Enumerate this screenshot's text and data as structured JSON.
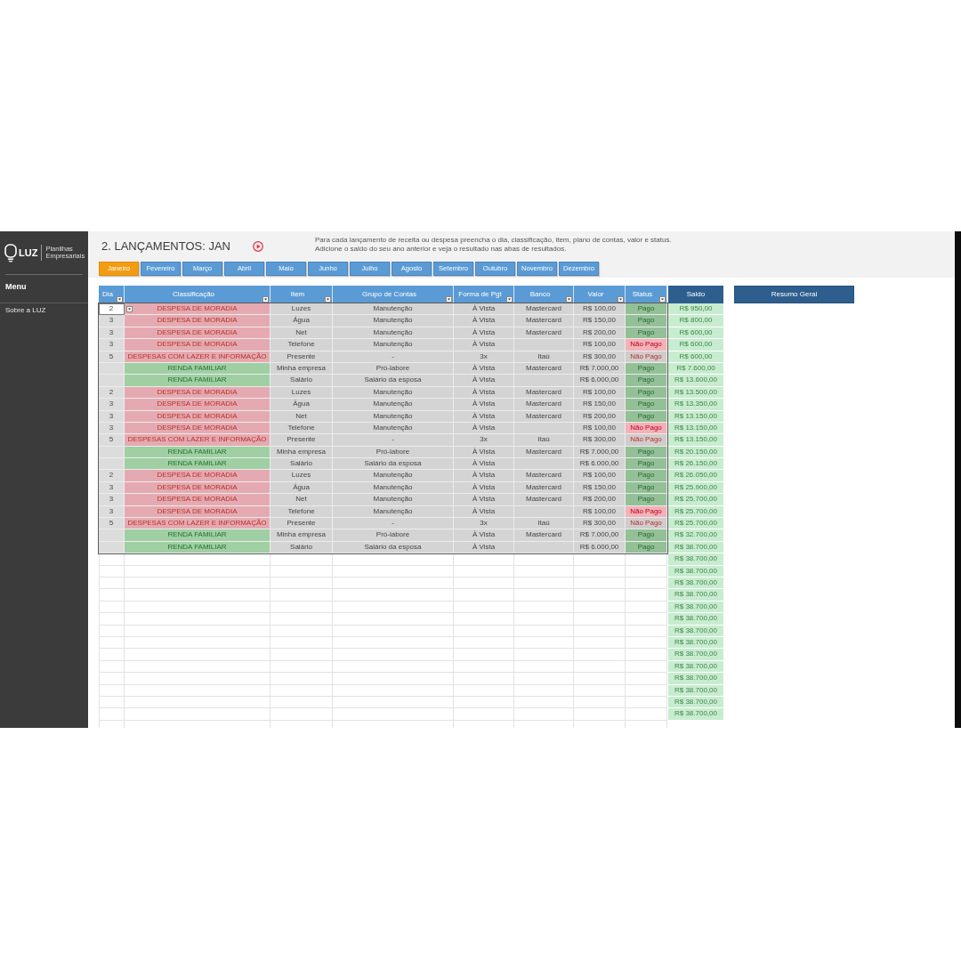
{
  "sidebar": {
    "logo_text": "LUZ",
    "logo_tagline": "Planilhas Empresariais",
    "menu_title": "Menu",
    "items": [
      {
        "label": "Sobre a LUZ"
      }
    ]
  },
  "header": {
    "title": "2. LANÇAMENTOS: JAN",
    "description": "Para cada lançamento de receita ou despesa preencha o dia, classificação, item, plano de contas, valor e status. Adicione o saldo do seu ano anterior e veja o resultado nas abas de resultados.",
    "months": [
      {
        "label": "Janeiro",
        "selected": true
      },
      {
        "label": "Fevereiro",
        "selected": false
      },
      {
        "label": "Março",
        "selected": false
      },
      {
        "label": "Abril",
        "selected": false
      },
      {
        "label": "Maio",
        "selected": false
      },
      {
        "label": "Junho",
        "selected": false
      },
      {
        "label": "Julho",
        "selected": false
      },
      {
        "label": "Agosto",
        "selected": false
      },
      {
        "label": "Setembro",
        "selected": false
      },
      {
        "label": "Outubro",
        "selected": false
      },
      {
        "label": "Novembro",
        "selected": false
      },
      {
        "label": "Dezembro",
        "selected": false
      }
    ]
  },
  "table": {
    "columns": [
      "Dia",
      "Classificação",
      "Item",
      "Grupo de Contas",
      "Forma de Pgt",
      "Banco",
      "Valor",
      "Status"
    ],
    "balance_column": "Saldo",
    "rows": [
      {
        "selected": true,
        "day": "2",
        "classification": {
          "label": "DESPESA DE MORADIA",
          "kind": "expense"
        },
        "item": "Luzes",
        "account_group": "Manutenção",
        "payment": "À Vista",
        "bank": "Mastercard",
        "value": "R$ 100,00",
        "status": {
          "label": "Pago",
          "kind": "paid"
        },
        "balance": "R$ 950,00"
      },
      {
        "selected": false,
        "day": "3",
        "classification": {
          "label": "DESPESA DE MORADIA",
          "kind": "expense"
        },
        "item": "Água",
        "account_group": "Manutenção",
        "payment": "À Vista",
        "bank": "Mastercard",
        "value": "R$ 150,00",
        "status": {
          "label": "Pago",
          "kind": "paid"
        },
        "balance": "R$ 800,00"
      },
      {
        "selected": false,
        "day": "3",
        "classification": {
          "label": "DESPESA DE MORADIA",
          "kind": "expense"
        },
        "item": "Net",
        "account_group": "Manutenção",
        "payment": "À Vista",
        "bank": "Mastercard",
        "value": "R$ 200,00",
        "status": {
          "label": "Pago",
          "kind": "paid"
        },
        "balance": "R$ 600,00"
      },
      {
        "selected": false,
        "day": "3",
        "classification": {
          "label": "DESPESA DE MORADIA",
          "kind": "expense"
        },
        "item": "Telefone",
        "account_group": "Manutenção",
        "payment": "À Vista",
        "value": "R$ 100,00",
        "status": {
          "label": "Não Pago",
          "kind": "overdue"
        },
        "balance": "R$ 600,00"
      },
      {
        "selected": false,
        "day": "5",
        "classification": {
          "label": "DESPESAS COM LAZER E INFORMAÇÃO",
          "kind": "expense"
        },
        "item": "Presente",
        "account_group": "-",
        "payment": "3x",
        "bank": "Itaú",
        "value": "R$ 300,00",
        "status": {
          "label": "Não Pago",
          "kind": "open"
        },
        "balance": "R$ 600,00"
      },
      {
        "selected": false,
        "classification": {
          "label": "RENDA FAMILIAR",
          "kind": "income"
        },
        "item": "Minha empresa",
        "account_group": "Pró-labore",
        "payment": "À Vista",
        "bank": "Mastercard",
        "value": "R$ 7.000,00",
        "status": {
          "label": "Pago",
          "kind": "paid"
        },
        "balance": "R$ 7.600,00"
      },
      {
        "selected": false,
        "classification": {
          "label": "RENDA FAMILIAR",
          "kind": "income"
        },
        "item": "Salário",
        "account_group": "Salário da esposa",
        "payment": "À Vista",
        "value": "R$ 6.000,00",
        "status": {
          "label": "Pago",
          "kind": "paid"
        },
        "balance": "R$ 13.600,00"
      },
      {
        "selected": false,
        "day": "2",
        "classification": {
          "label": "DESPESA DE MORADIA",
          "kind": "expense"
        },
        "item": "Luzes",
        "account_group": "Manutenção",
        "payment": "À Vista",
        "bank": "Mastercard",
        "value": "R$ 100,00",
        "status": {
          "label": "Pago",
          "kind": "paid"
        },
        "balance": "R$ 13.500,00"
      },
      {
        "selected": false,
        "day": "3",
        "classification": {
          "label": "DESPESA DE MORADIA",
          "kind": "expense"
        },
        "item": "Água",
        "account_group": "Manutenção",
        "payment": "À Vista",
        "bank": "Mastercard",
        "value": "R$ 150,00",
        "status": {
          "label": "Pago",
          "kind": "paid"
        },
        "balance": "R$ 13.350,00"
      },
      {
        "selected": false,
        "day": "3",
        "classification": {
          "label": "DESPESA DE MORADIA",
          "kind": "expense"
        },
        "item": "Net",
        "account_group": "Manutenção",
        "payment": "À Vista",
        "bank": "Mastercard",
        "value": "R$ 200,00",
        "status": {
          "label": "Pago",
          "kind": "paid"
        },
        "balance": "R$ 13.150,00"
      },
      {
        "selected": false,
        "day": "3",
        "classification": {
          "label": "DESPESA DE MORADIA",
          "kind": "expense"
        },
        "item": "Telefone",
        "account_group": "Manutenção",
        "payment": "À Vista",
        "value": "R$ 100,00",
        "status": {
          "label": "Não Pago",
          "kind": "overdue"
        },
        "balance": "R$ 13.150,00"
      },
      {
        "selected": false,
        "day": "5",
        "classification": {
          "label": "DESPESAS COM LAZER E INFORMAÇÃO",
          "kind": "expense"
        },
        "item": "Presente",
        "account_group": "-",
        "payment": "3x",
        "bank": "Itaú",
        "value": "R$ 300,00",
        "status": {
          "label": "Não Pago",
          "kind": "open"
        },
        "balance": "R$ 13.150,00"
      },
      {
        "selected": false,
        "classification": {
          "label": "RENDA FAMILIAR",
          "kind": "income"
        },
        "item": "Minha empresa",
        "account_group": "Pró-labore",
        "payment": "À Vista",
        "bank": "Mastercard",
        "value": "R$ 7.000,00",
        "status": {
          "label": "Pago",
          "kind": "paid"
        },
        "balance": "R$ 20.150,00"
      },
      {
        "selected": false,
        "classification": {
          "label": "RENDA FAMILIAR",
          "kind": "income"
        },
        "item": "Salário",
        "account_group": "Salário da esposa",
        "payment": "À Vista",
        "value": "R$ 6.000,00",
        "status": {
          "label": "Pago",
          "kind": "paid"
        },
        "balance": "R$ 26.150,00"
      },
      {
        "selected": false,
        "day": "2",
        "classification": {
          "label": "DESPESA DE MORADIA",
          "kind": "expense"
        },
        "item": "Luzes",
        "account_group": "Manutenção",
        "payment": "À Vista",
        "bank": "Mastercard",
        "value": "R$ 100,00",
        "status": {
          "label": "Pago",
          "kind": "paid"
        },
        "balance": "R$ 26.050,00"
      },
      {
        "selected": false,
        "day": "3",
        "classification": {
          "label": "DESPESA DE MORADIA",
          "kind": "expense"
        },
        "item": "Água",
        "account_group": "Manutenção",
        "payment": "À Vista",
        "bank": "Mastercard",
        "value": "R$ 150,00",
        "status": {
          "label": "Pago",
          "kind": "paid"
        },
        "balance": "R$ 25.900,00"
      },
      {
        "selected": false,
        "day": "3",
        "classification": {
          "label": "DESPESA DE MORADIA",
          "kind": "expense"
        },
        "item": "Net",
        "account_group": "Manutenção",
        "payment": "À Vista",
        "bank": "Mastercard",
        "value": "R$ 200,00",
        "status": {
          "label": "Pago",
          "kind": "paid"
        },
        "balance": "R$ 25.700,00"
      },
      {
        "selected": false,
        "day": "3",
        "classification": {
          "label": "DESPESA DE MORADIA",
          "kind": "expense"
        },
        "item": "Telefone",
        "account_group": "Manutenção",
        "payment": "À Vista",
        "value": "R$ 100,00",
        "status": {
          "label": "Não Pago",
          "kind": "overdue"
        },
        "balance": "R$ 25.700,00"
      },
      {
        "selected": false,
        "day": "5",
        "classification": {
          "label": "DESPESAS COM LAZER E INFORMAÇÃO",
          "kind": "expense"
        },
        "item": "Presente",
        "account_group": "-",
        "payment": "3x",
        "bank": "Itaú",
        "value": "R$ 300,00",
        "status": {
          "label": "Não Pago",
          "kind": "open"
        },
        "balance": "R$ 25.700,00"
      },
      {
        "selected": false,
        "classification": {
          "label": "RENDA FAMILIAR",
          "kind": "income"
        },
        "item": "Minha empresa",
        "account_group": "Pró-labore",
        "payment": "À Vista",
        "bank": "Mastercard",
        "value": "R$ 7.000,00",
        "status": {
          "label": "Pago",
          "kind": "paid"
        },
        "balance": "R$ 32.700,00"
      },
      {
        "selected": false,
        "classification": {
          "label": "RENDA FAMILIAR",
          "kind": "income"
        },
        "item": "Salário",
        "account_group": "Salário da esposa",
        "payment": "À Vista",
        "value": "R$ 6.000,00",
        "status": {
          "label": "Pago",
          "kind": "paid"
        },
        "balance": "R$ 38.700,00"
      }
    ],
    "balance_only_rows": [
      "R$ 38.700,00",
      "R$ 38.700,00",
      "R$ 38.700,00",
      "R$ 38.700,00",
      "R$ 38.700,00",
      "R$ 38.700,00",
      "R$ 38.700,00",
      "R$ 38.700,00",
      "R$ 38.700,00",
      "R$ 38.700,00",
      "R$ 38.700,00",
      "R$ 38.700,00",
      "R$ 38.700,00",
      "R$ 38.700,00"
    ]
  },
  "summary_button": "Resumo Geral"
}
